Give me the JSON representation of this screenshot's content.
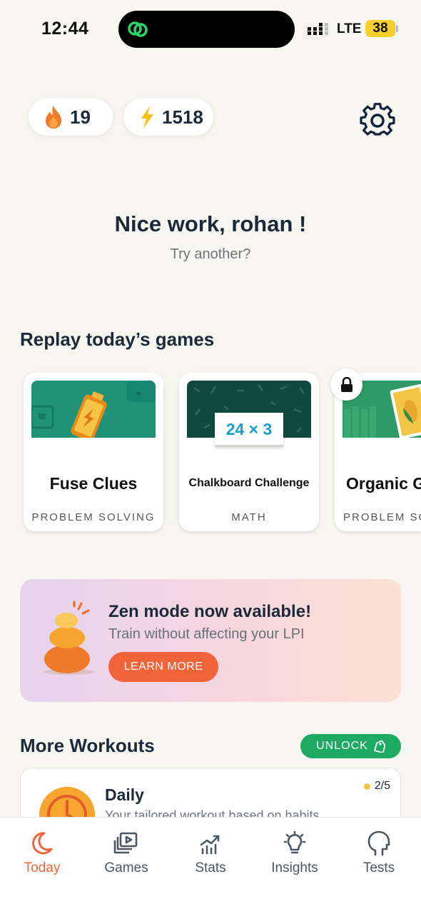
{
  "status": {
    "time": "12:44",
    "network": "LTE",
    "battery": "38"
  },
  "stats": {
    "streak": "19",
    "energy": "1518"
  },
  "greeting": {
    "title": "Nice work, rohan !",
    "subtitle": "Try another?"
  },
  "replay": {
    "title": "Replay today’s games",
    "games": [
      {
        "title": "Fuse Clues",
        "category": "PROBLEM SOLVING",
        "locked": false
      },
      {
        "title": "Chalkboard Challenge",
        "category": "MATH",
        "art_text": "24 × 3",
        "locked": false
      },
      {
        "title": "Organic G",
        "category": "PROBLEM SO",
        "locked": true
      }
    ]
  },
  "zen": {
    "title": "Zen mode now available!",
    "subtitle": "Train without affecting your LPI",
    "button": "LEARN MORE"
  },
  "workouts": {
    "title": "More Workouts",
    "unlock": "UNLOCK",
    "daily": {
      "title": "Daily",
      "subtitle": "Your tailored workout based on habits",
      "progress": "2/5"
    }
  },
  "tabs": [
    {
      "label": "Today",
      "icon": "moon-icon",
      "active": true
    },
    {
      "label": "Games",
      "icon": "games-icon",
      "active": false
    },
    {
      "label": "Stats",
      "icon": "stats-icon",
      "active": false
    },
    {
      "label": "Insights",
      "icon": "lightbulb-icon",
      "active": false
    },
    {
      "label": "Tests",
      "icon": "head-icon",
      "active": false
    }
  ],
  "colors": {
    "accent": "#f1643a",
    "unlock": "#1eaa63",
    "background": "#f8f6f1",
    "text": "#1b2a3a"
  }
}
